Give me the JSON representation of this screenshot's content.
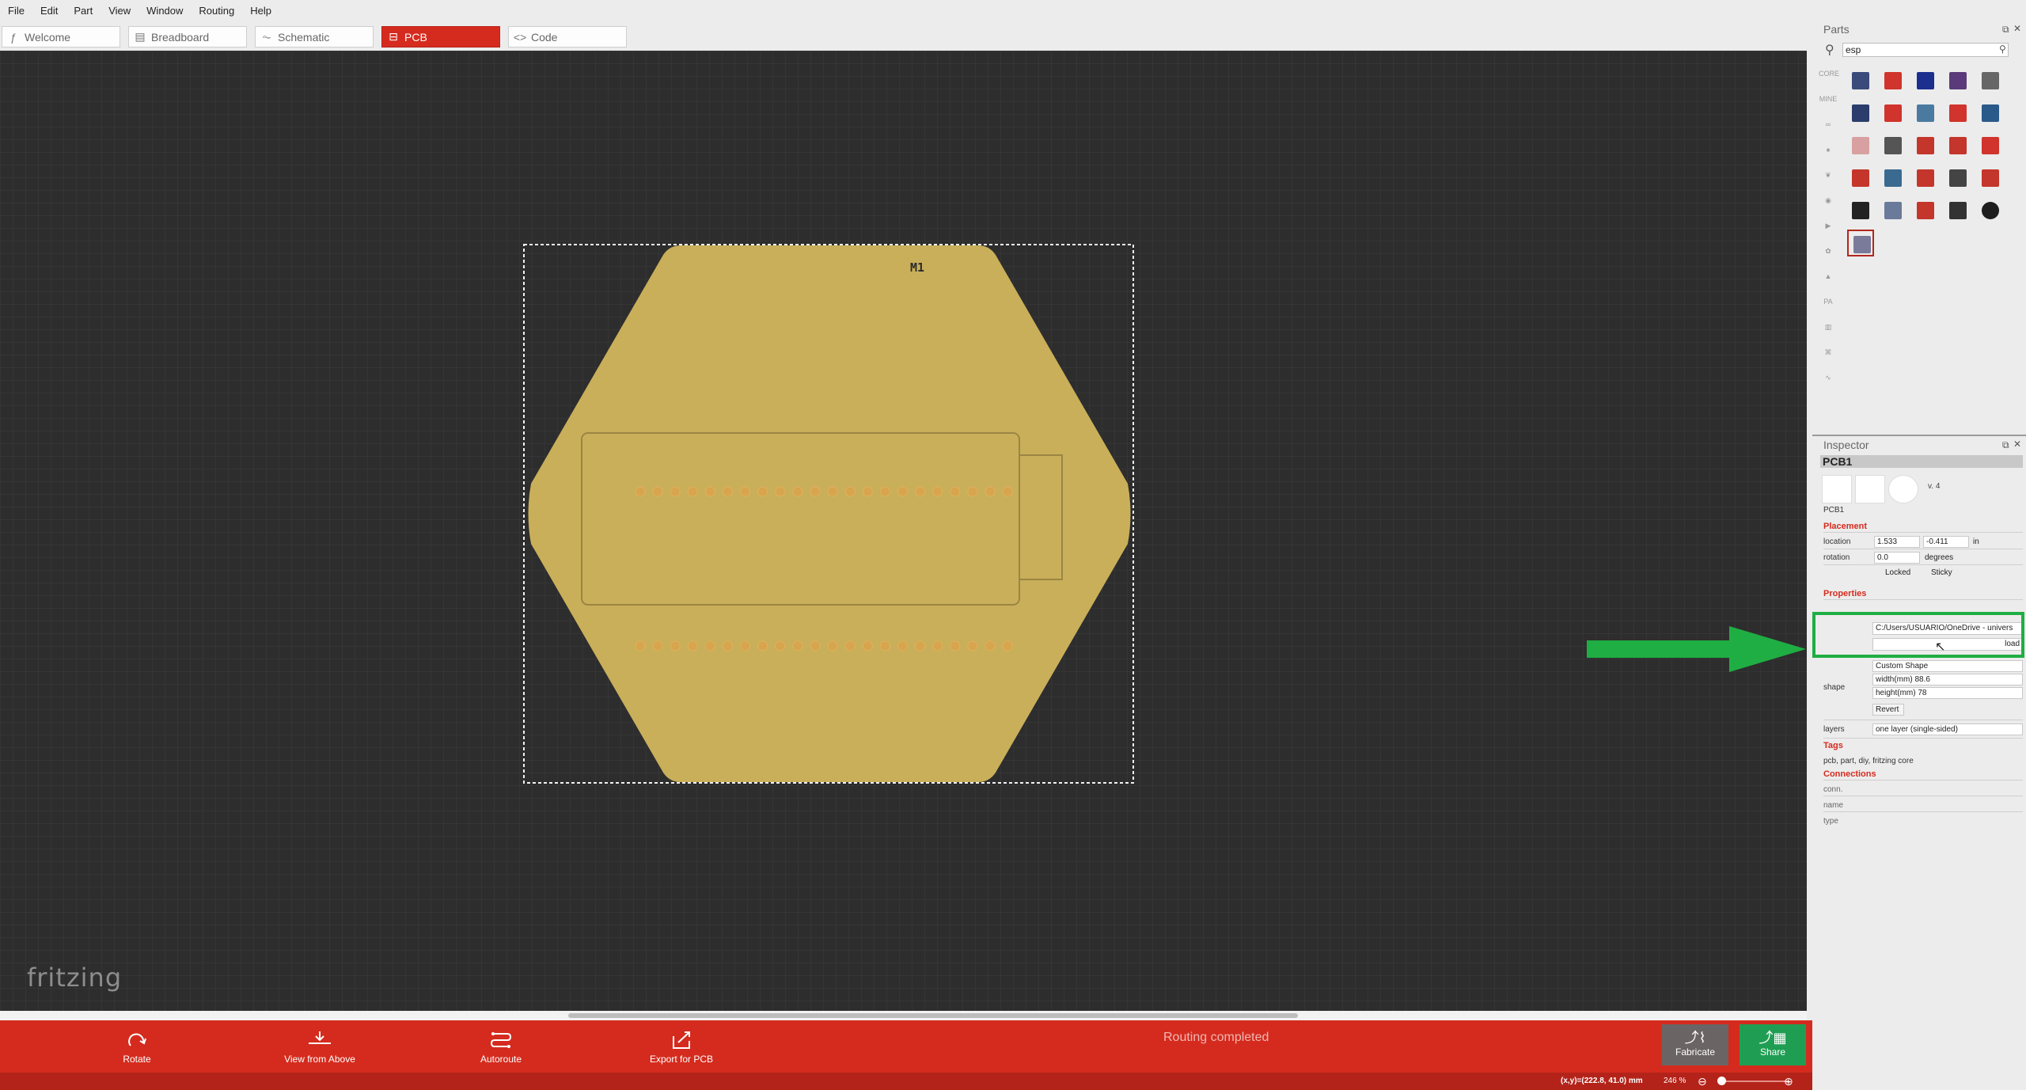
{
  "menu": [
    "File",
    "Edit",
    "Part",
    "View",
    "Window",
    "Routing",
    "Help"
  ],
  "tabs": [
    {
      "label": "Welcome",
      "icon": "fritzing-f-icon"
    },
    {
      "label": "Breadboard",
      "icon": "breadboard-icon"
    },
    {
      "label": "Schematic",
      "icon": "schematic-icon"
    },
    {
      "label": "PCB",
      "icon": "pcb-icon"
    },
    {
      "label": "Code",
      "icon": "code-icon"
    }
  ],
  "active_tab": "PCB",
  "canvas": {
    "part_label": "M1",
    "logo": "fritzing",
    "board_color": "#c9af5a",
    "background_color": "#2d2d2d"
  },
  "toolbar": {
    "rotate": "Rotate",
    "view_from_above": "View from Above",
    "autoroute": "Autoroute",
    "export_for_pcb": "Export for PCB",
    "status": "Routing completed",
    "fabricate": "Fabricate",
    "share": "Share"
  },
  "statusbar": {
    "coords": "(x,y)=(222.8, 41.0) mm",
    "zoom": "246 %"
  },
  "parts": {
    "title": "Parts",
    "search_value": "esp",
    "bins": [
      "CORE",
      "MINE"
    ]
  },
  "inspector": {
    "title": "Inspector",
    "part_title": "PCB1",
    "version": "v. 4",
    "part_name": "PCB1",
    "placement_title": "Placement",
    "location_label": "location",
    "location_x": "1.533",
    "location_y": "-0.411",
    "location_unit": "in",
    "rotation_label": "rotation",
    "rotation_value": "0.0",
    "rotation_unit": "degrees",
    "locked": "Locked",
    "sticky": "Sticky",
    "properties_title": "Properties",
    "image_path": "C:/Users/USUARIO/OneDrive - univers",
    "load_button": "load",
    "shape_label": "shape",
    "shape_value": "Custom Shape",
    "width": "width(mm) 88.6",
    "height": "height(mm) 78",
    "revert_button": "Revert",
    "layers_label": "layers",
    "layers_value": "one layer (single-sided)",
    "tags_title": "Tags",
    "tags_value": "pcb, part, diy, fritzing core",
    "connections_title": "Connections",
    "conn_label": "conn.",
    "name_label": "name",
    "type_label": "type"
  },
  "annotation": {
    "arrow_color": "#1fae43"
  }
}
